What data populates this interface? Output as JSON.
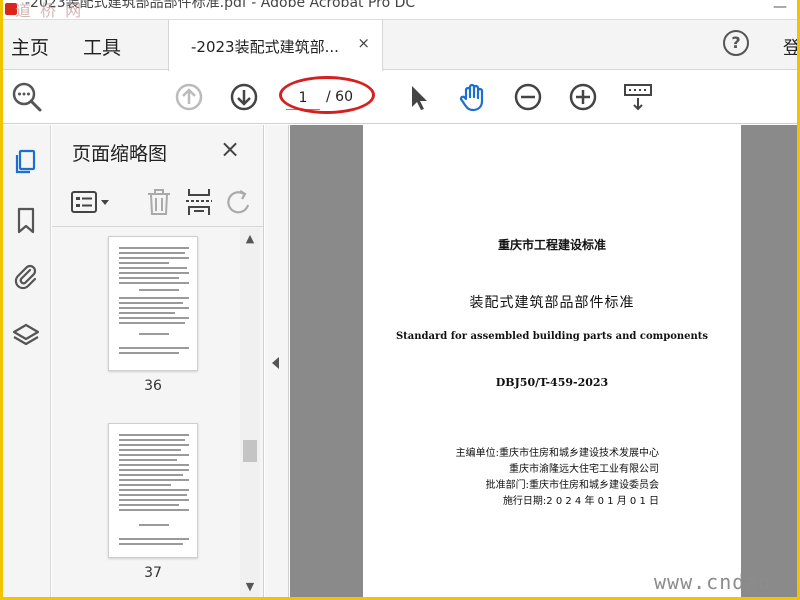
{
  "window": {
    "title": "-2023装配式建筑部品部件标准.pdf - Adobe Acrobat Pro DC",
    "watermark": "道 桥 网",
    "minimize": "—"
  },
  "tabs": {
    "home": "主页",
    "tools": "工具",
    "document": "-2023装配式建筑部...",
    "close": "×",
    "help": "?",
    "signin": "登"
  },
  "toolbar": {
    "page_current": "1",
    "page_total": "/ 60"
  },
  "thumbnails_panel": {
    "title": "页面缩略图",
    "close": "×",
    "pages": [
      {
        "number": "36"
      },
      {
        "number": "37"
      }
    ]
  },
  "document_page": {
    "org": "重庆市工程建设标准",
    "title": "装配式建筑部品部件标准",
    "title_en": "Standard for assembled building parts and components",
    "code": "DBJ50/T-459-2023",
    "editor_line1": "主编单位:重庆市住房和城乡建设技术发展中心",
    "editor_line2": "重庆市渝隆远大住宅工业有限公司",
    "approval": "批准部门:重庆市住房和城乡建设委员会",
    "effective_date": "施行日期:2 0 2 4 年 0 1 月 0 1 日"
  },
  "site_watermark": "www.cndao",
  "colors": {
    "frame": "#f0c400",
    "accent_blue": "#1a6fd1",
    "annotation_red": "#d62020"
  }
}
